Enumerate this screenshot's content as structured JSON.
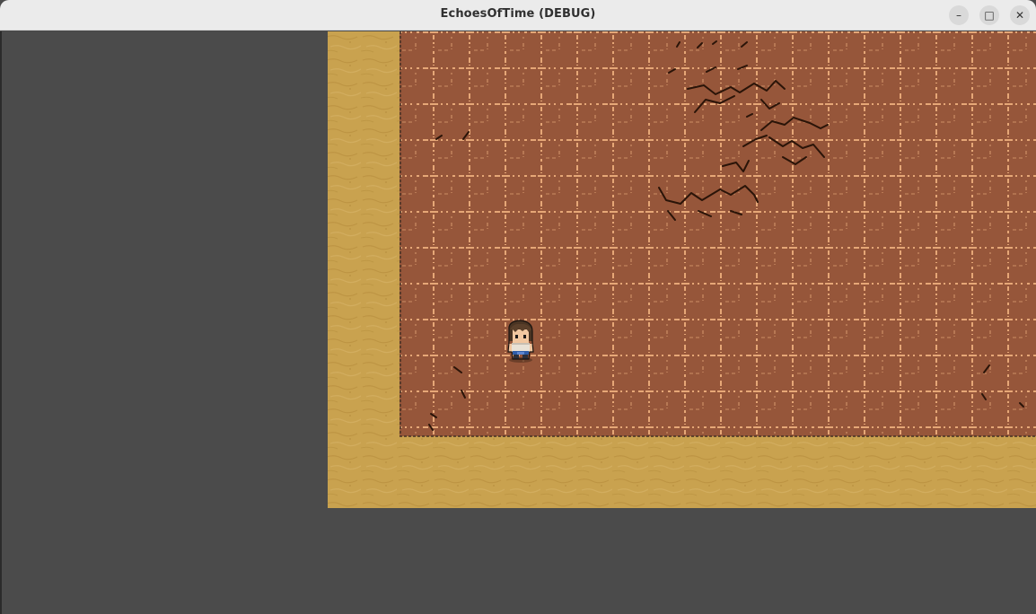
{
  "window": {
    "title": "EchoesOfTime (DEBUG)",
    "controls": {
      "minimize_glyph": "–",
      "maximize_glyph": "□",
      "close_glyph": "✕"
    }
  },
  "scene": {
    "map": {
      "sand_color": "#c9a24f",
      "floor_color": "#96563a",
      "grout_color": "#e6a777",
      "crack_color": "#2a1408",
      "background_color": "#4b4b4b"
    },
    "player": {
      "name": "player-character",
      "hair_color": "#4a3423",
      "skin_color": "#f2c7a0",
      "shirt_color": "#e9e2d6",
      "pants_color": "#2e5da8"
    }
  }
}
